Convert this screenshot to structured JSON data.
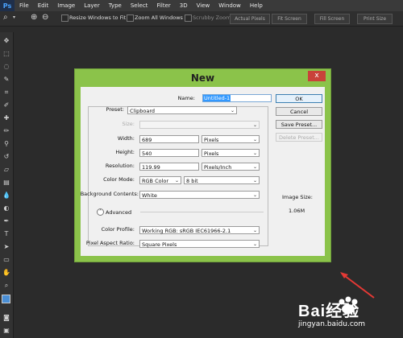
{
  "app": {
    "logo": "Ps"
  },
  "menu": [
    "File",
    "Edit",
    "Image",
    "Layer",
    "Type",
    "Select",
    "Filter",
    "3D",
    "View",
    "Window",
    "Help"
  ],
  "options": {
    "resize_windows": "Resize Windows to Fit",
    "zoom_all": "Zoom All Windows",
    "scrubby_zoom": "Scrubby Zoom",
    "actual_pixels": "Actual Pixels",
    "fit_screen": "Fit Screen",
    "fill_screen": "Fill Screen",
    "print_size": "Print Size"
  },
  "dialog": {
    "title": "New",
    "close": "x",
    "name_label": "Name:",
    "name_value": "Untitled-1",
    "preset_label": "Preset:",
    "preset_value": "Clipboard",
    "size_label": "Size:",
    "width_label": "Width:",
    "width_value": "689",
    "width_unit": "Pixels",
    "height_label": "Height:",
    "height_value": "540",
    "height_unit": "Pixels",
    "resolution_label": "Resolution:",
    "resolution_value": "119.99",
    "resolution_unit": "Pixels/Inch",
    "color_mode_label": "Color Mode:",
    "color_mode_value": "RGB Color",
    "bit_depth": "8 bit",
    "bg_label": "Background Contents:",
    "bg_value": "White",
    "advanced_label": "Advanced",
    "profile_label": "Color Profile:",
    "profile_value": "Working RGB:  sRGB IEC61966-2.1",
    "aspect_label": "Pixel Aspect Ratio:",
    "aspect_value": "Square Pixels",
    "ok": "OK",
    "cancel": "Cancel",
    "save_preset": "Save Preset...",
    "delete_preset": "Delete Preset...",
    "image_size_label": "Image Size:",
    "image_size_value": "1.06M"
  },
  "watermark": {
    "text": "Bai经验",
    "url": "jingyan.baidu.com"
  },
  "colors": {
    "dialog_frame": "#8bc34a",
    "close_button": "#c9423a",
    "arrow": "#e53935"
  }
}
